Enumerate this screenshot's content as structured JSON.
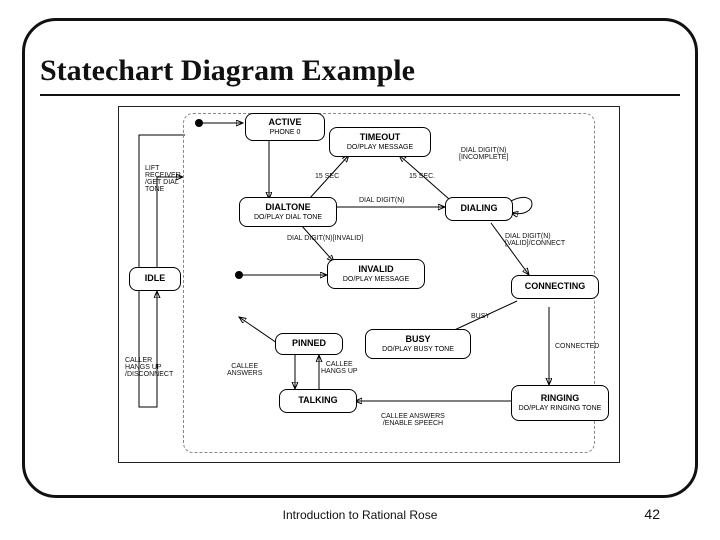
{
  "slide": {
    "title": "Statechart Diagram Example",
    "footer": "Introduction to Rational Rose",
    "page": "42"
  },
  "states": {
    "active": {
      "name": "ACTIVE",
      "sub": "PHONE 0"
    },
    "timeout": {
      "name": "TIMEOUT",
      "sub": "DO/PLAY MESSAGE"
    },
    "dialtone": {
      "name": "DIALTONE",
      "sub": "DO/PLAY DIAL TONE"
    },
    "dialing": {
      "name": "DIALING"
    },
    "invalid": {
      "name": "INVALID",
      "sub": "DO/PLAY MESSAGE"
    },
    "connecting": {
      "name": "CONNECTING"
    },
    "idle": {
      "name": "IDLE"
    },
    "pinned": {
      "name": "PINNED"
    },
    "busy": {
      "name": "BUSY",
      "sub": "DO/PLAY BUSY TONE"
    },
    "talking": {
      "name": "TALKING"
    },
    "ringing": {
      "name": "RINGING",
      "sub": "DO/PLAY RINGING\nTONE"
    }
  },
  "transitions": {
    "lift_receiver": "LIFT\nRECEIVER\n/GET DIAL\nTONE",
    "t15sec_a": "15 SEC",
    "t15sec_b": "15 SEC.",
    "dial_digit_n_incomplete": "DIAL DIGIT(N)\n[INCOMPLETE]",
    "dial_digit_n": "DIAL DIGIT(N)",
    "dial_digit_invalid": "DIAL DIGIT(N)[INVALID]",
    "dial_digit_valid_connect": "DIAL DIGIT(N)\n[VALID]/CONNECT",
    "busy_evt": "BUSY",
    "connected": "CONNECTED",
    "caller_hangs_up": "CALLER\nHANGS UP\n/DISCONNECT",
    "callee_answers": "CALLEE\nANSWERS",
    "callee_hangs_up": "CALLEE\nHANGS UP",
    "callee_answers_enable": "CALLEE ANSWERS\n/ENABLE SPEECH"
  }
}
